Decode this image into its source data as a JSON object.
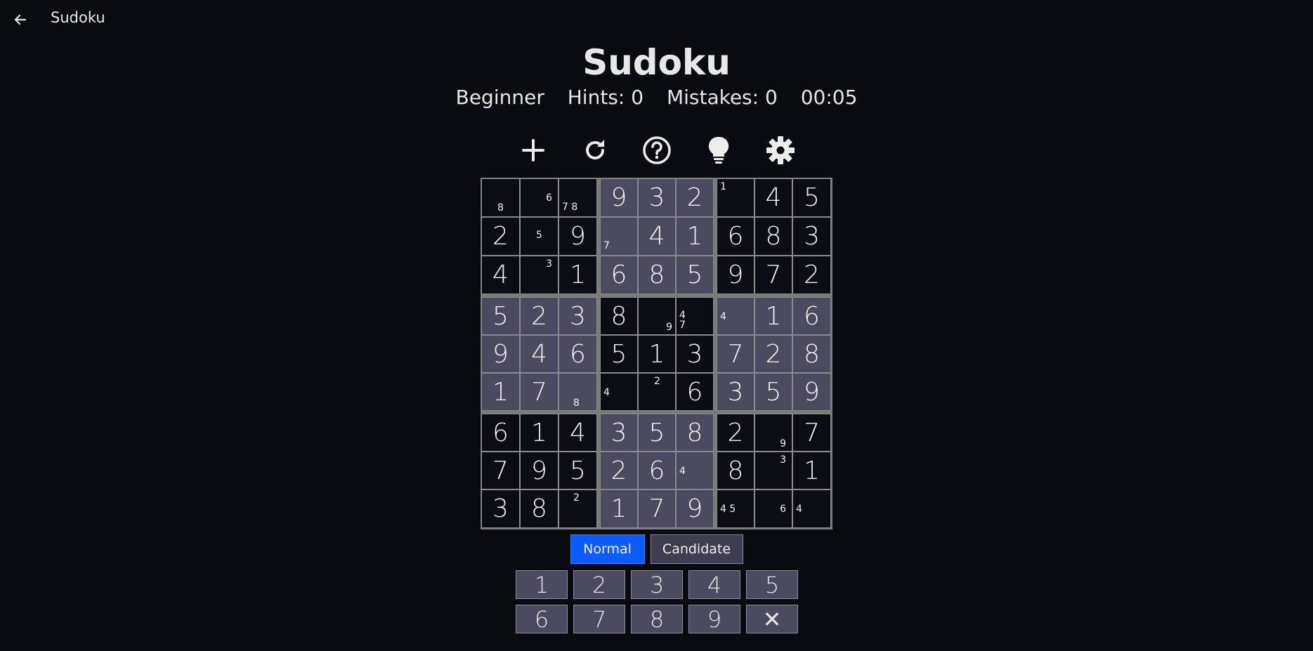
{
  "header": {
    "title": "Sudoku"
  },
  "game": {
    "title": "Sudoku",
    "difficulty": "Beginner",
    "hints": "Hints: 0",
    "mistakes": "Mistakes: 0",
    "timer": "00:05"
  },
  "toolbar": [
    {
      "name": "new-game-icon"
    },
    {
      "name": "restart-icon"
    },
    {
      "name": "help-icon"
    },
    {
      "name": "hint-bulb-icon"
    },
    {
      "name": "settings-gear-icon"
    }
  ],
  "board": {
    "values": [
      [
        "",
        "",
        "",
        "9",
        "3",
        "2",
        "",
        "4",
        "5"
      ],
      [
        "2",
        "",
        "9",
        "",
        "4",
        "1",
        "6",
        "8",
        "3"
      ],
      [
        "4",
        "",
        "1",
        "6",
        "8",
        "5",
        "9",
        "7",
        "2"
      ],
      [
        "5",
        "2",
        "3",
        "8",
        "",
        "",
        "",
        "1",
        "6"
      ],
      [
        "9",
        "4",
        "6",
        "5",
        "1",
        "3",
        "7",
        "2",
        "8"
      ],
      [
        "1",
        "7",
        "",
        "",
        "",
        "6",
        "3",
        "5",
        "9"
      ],
      [
        "6",
        "1",
        "4",
        "3",
        "5",
        "8",
        "2",
        "",
        "7"
      ],
      [
        "7",
        "9",
        "5",
        "2",
        "6",
        "",
        "8",
        "",
        "1"
      ],
      [
        "3",
        "8",
        "",
        "1",
        "7",
        "9",
        "",
        "",
        ""
      ]
    ],
    "candidates": [
      [
        "8",
        "6",
        "7 8",
        "",
        "",
        "",
        "1",
        "",
        ""
      ],
      [
        "",
        "5",
        "",
        "7",
        "",
        "",
        "",
        "",
        ""
      ],
      [
        "",
        "3",
        "",
        "",
        "",
        "",
        "",
        "",
        ""
      ],
      [
        "",
        "",
        "",
        "",
        "9",
        "4\n7",
        "4",
        "",
        ""
      ],
      [
        "",
        "",
        "",
        "",
        "",
        "",
        "",
        "",
        ""
      ],
      [
        "",
        "",
        "8",
        "4",
        "2",
        "",
        "",
        "",
        ""
      ],
      [
        "",
        "",
        "",
        "",
        "",
        "",
        "",
        "9",
        ""
      ],
      [
        "",
        "",
        "",
        "",
        "",
        "4",
        "",
        "3",
        ""
      ],
      [
        "",
        "",
        "2",
        "",
        "",
        "",
        "4 5",
        "6",
        "4"
      ]
    ],
    "shading": [
      [
        "d",
        "d",
        "d",
        "l",
        "l",
        "l",
        "d",
        "d",
        "d"
      ],
      [
        "d",
        "d",
        "d",
        "l",
        "l",
        "l",
        "d",
        "d",
        "d"
      ],
      [
        "d",
        "d",
        "d",
        "l",
        "l",
        "l",
        "d",
        "d",
        "d"
      ],
      [
        "l",
        "l",
        "l",
        "d",
        "d",
        "d",
        "l",
        "l",
        "l"
      ],
      [
        "l",
        "l",
        "l",
        "d",
        "d",
        "d",
        "l",
        "l",
        "l"
      ],
      [
        "l",
        "l",
        "l",
        "d",
        "d",
        "d",
        "l",
        "l",
        "l"
      ],
      [
        "d",
        "d",
        "d",
        "l",
        "l",
        "l",
        "d",
        "d",
        "d"
      ],
      [
        "d",
        "d",
        "d",
        "l",
        "l",
        "l",
        "d",
        "d",
        "d"
      ],
      [
        "d",
        "d",
        "d",
        "l",
        "l",
        "l",
        "d",
        "d",
        "d"
      ]
    ]
  },
  "modes": {
    "normal": "Normal",
    "candidate": "Candidate"
  },
  "numpad": [
    "1",
    "2",
    "3",
    "4",
    "5",
    "6",
    "7",
    "8",
    "9",
    "✕"
  ],
  "colors": {
    "background": "#090b10",
    "accent": "#0a5cff",
    "cell_light": "#4a4b5e",
    "cell_dark": "#0b0d14"
  }
}
